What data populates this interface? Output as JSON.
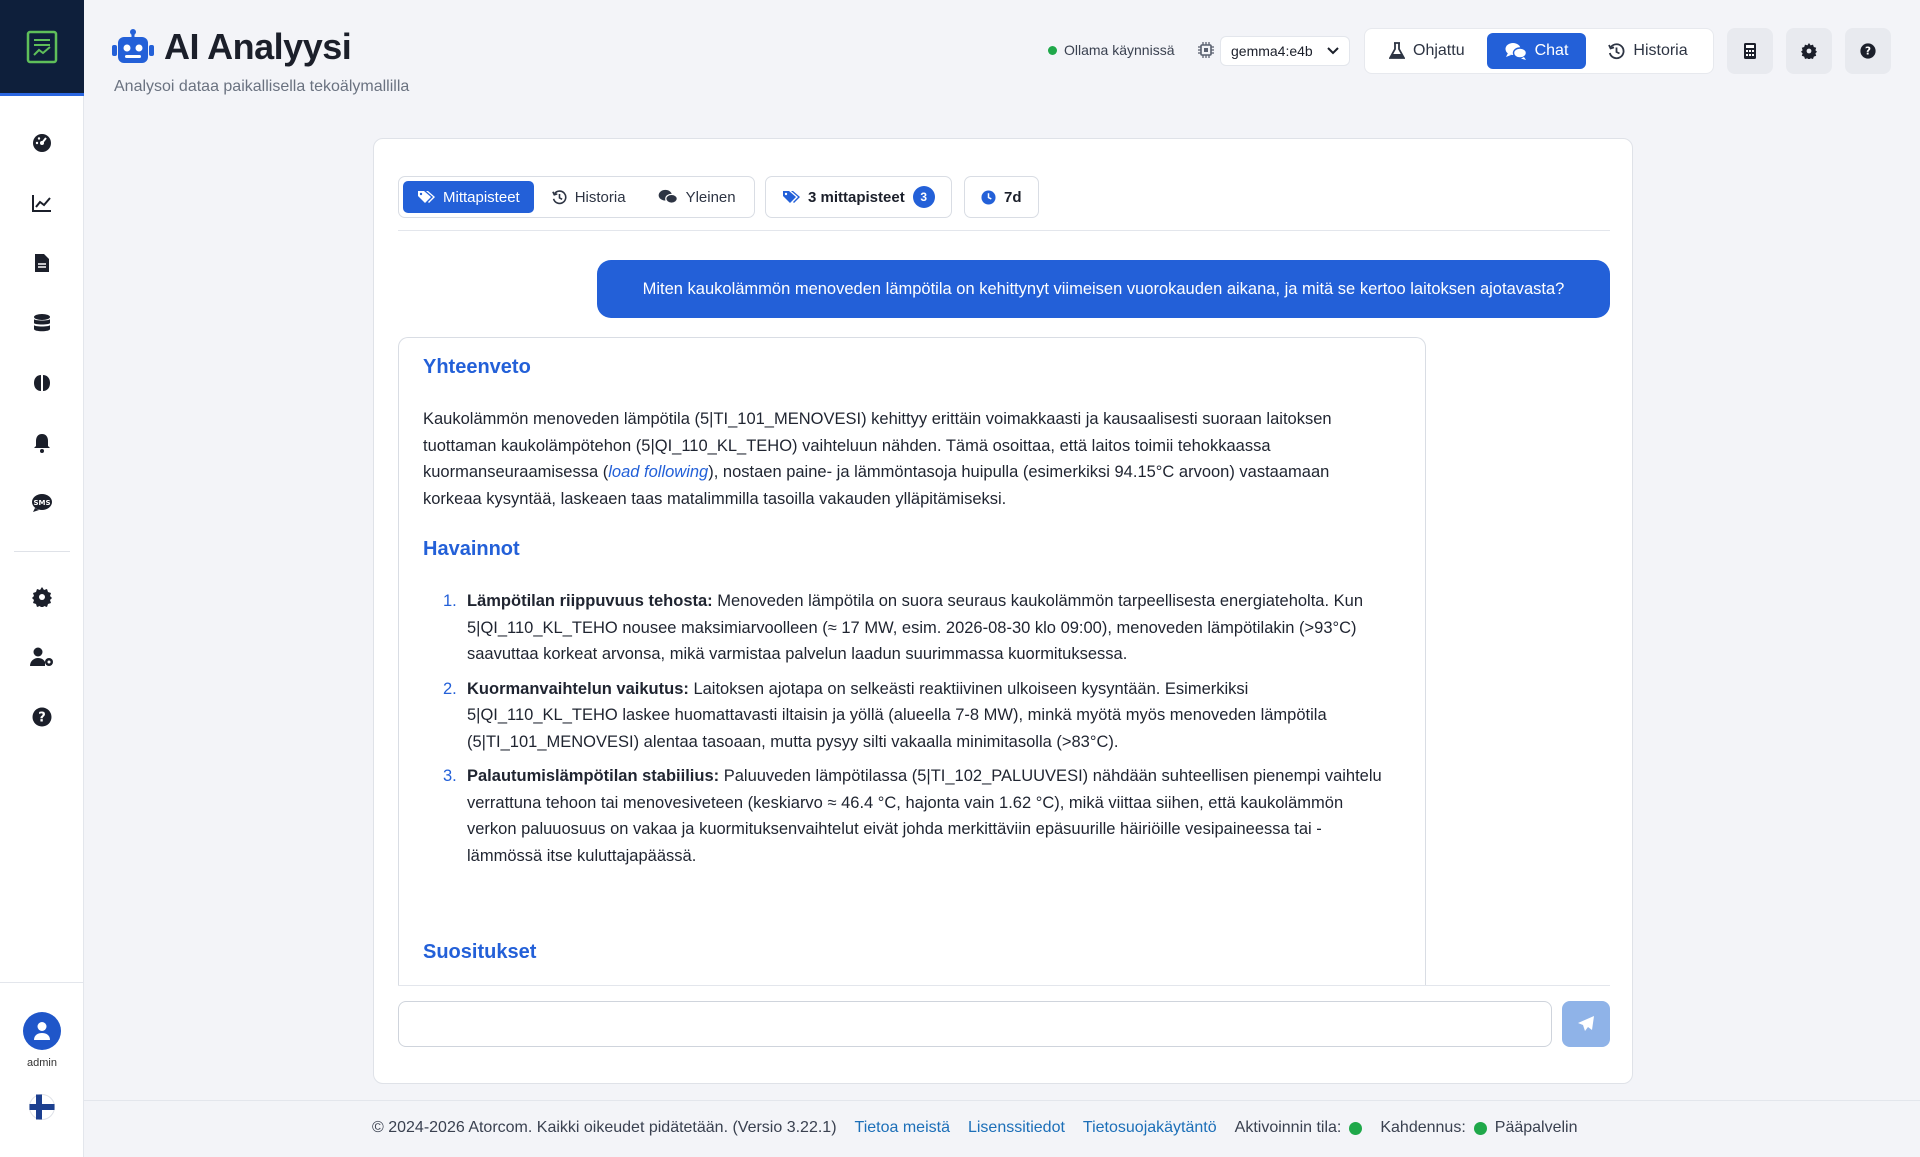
{
  "header": {
    "title": "AI Analyysi",
    "subtitle": "Analysoi dataa paikallisella tekoälymallilla",
    "status_text": "Ollama käynnissä",
    "model": "gemma4:e4b",
    "modes": [
      {
        "label": "Ohjattu",
        "icon": "flask-icon"
      },
      {
        "label": "Chat",
        "icon": "chat-bubbles-icon",
        "active": true
      },
      {
        "label": "Historia",
        "icon": "history-icon"
      }
    ],
    "icon_buttons": [
      "calculator-icon",
      "gear-icon",
      "help-icon"
    ]
  },
  "sidebar": {
    "items": [
      "dashboard-gauge-icon",
      "line-chart-icon",
      "document-icon",
      "database-icon",
      "brain-icon",
      "bell-icon",
      "sms-icon",
      "gear-icon",
      "user-settings-icon",
      "help-icon"
    ],
    "user": "admin"
  },
  "chat": {
    "tabs": [
      {
        "label": "Mittapisteet",
        "icon": "tags-icon",
        "active": true
      },
      {
        "label": "Historia",
        "icon": "history-icon"
      },
      {
        "label": "Yleinen",
        "icon": "comments-icon"
      }
    ],
    "points_label": "3 mittapisteet",
    "points_count": "3",
    "range_label": "7d",
    "user_message": "Miten kaukolämmön menoveden lämpötila on kehittynyt viimeisen vuorokauden aikana, ja mitä se kertoo laitoksen ajotavasta?",
    "answer": {
      "summary_heading": "Yhteenveto",
      "summary_before": "Kaukolämmön menoveden lämpötila (5|TI_101_MENOVESI) kehittyy erittäin voimakkaasti ja kausaalisesti suoraan laitoksen tuottaman kaukolämpötehon (5|QI_110_KL_TEHO) vaihteluun nähden. Tämä osoittaa, että laitos toimii tehokkaassa kuormanseuraamisessa (",
      "summary_em": "load following",
      "summary_after": "), nostaen paine- ja lämmöntasoja huipulla (esimerkiksi 94.15°C arvoon) vastaamaan korkeaa kysyntää, laskeaen taas matalimmilla tasoilla vakauden ylläpitämiseksi.",
      "findings_heading": "Havainnot",
      "findings": [
        {
          "num": "1.",
          "title": "Lämpötilan riippuvuus tehosta:",
          "text": " Menoveden lämpötila on suora seuraus kaukolämmön tarpeellisesta energiateholta. Kun 5|QI_110_KL_TEHO nousee maksimiarvoolleen (≈ 17 MW, esim. 2026-08-30 klo 09:00), menoveden lämpötilakin (>93°C) saavuttaa korkeat arvonsa, mikä varmistaa palvelun laadun suurimmassa kuormituksessa."
        },
        {
          "num": "2.",
          "title": "Kuormanvaihtelun vaikutus:",
          "text": " Laitoksen ajotapa on selkeästi reaktiivinen ulkoiseen kysyntään. Esimerkiksi 5|QI_110_KL_TEHO laskee huomattavasti iltaisin ja yöllä (alueella 7-8 MW), minkä myötä myös menoveden lämpötila (5|TI_101_MENOVESI) alentaa tasoaan, mutta pysyy silti vakaalla minimitasolla (>83°C)."
        },
        {
          "num": "3.",
          "title": "Palautumislämpötilan stabiilius:",
          "text": " Paluuveden lämpötilassa (5|TI_102_PALUUVESI) nähdään suhteellisen pienempi vaihtelu verrattuna tehoon tai menovesiveteen (keskiarvo ≈ 46.4 °C, hajonta vain 1.62 °C), mikä viittaa siihen, että kaukolämmön verkon paluuosuus on vakaa ja kuormituksenvaihtelut eivät johda merkittäviin epäsuurille häiriöille vesipaineessa tai -lämmössä itse kuluttajapäässä."
        }
      ],
      "recommendations_heading": "Suositukset"
    },
    "input_value": ""
  },
  "footer": {
    "copyright": "© 2024-2026 Atorcom. Kaikki oikeudet pidätetään. (Versio 3.22.1)",
    "links": [
      "Tietoa meistä",
      "Lisenssitiedot",
      "Tietosuojakäytäntö"
    ],
    "activation_label": "Aktivoinnin tila:",
    "redundancy_label": "Kahdennus:",
    "server_label": "Pääpalvelin"
  },
  "colors": {
    "accent": "#2360d8",
    "sidebar_dark": "#0e1f3b",
    "status_ok": "#1fa84a"
  }
}
